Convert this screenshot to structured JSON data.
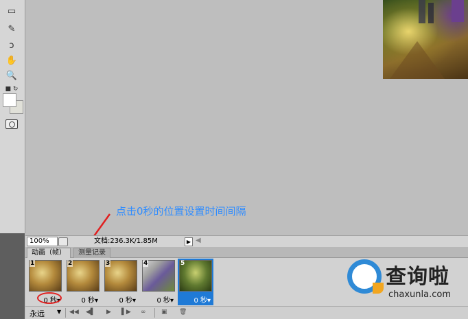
{
  "toolbar": {
    "tools": [
      {
        "name": "marquee-tool-icon",
        "glyph": "▭"
      },
      {
        "name": "quick-selection-tool-icon",
        "glyph": "✎"
      },
      {
        "name": "lasso-tool-icon",
        "glyph": "ↄ"
      },
      {
        "name": "hand-tool-icon",
        "glyph": "✋"
      },
      {
        "name": "zoom-tool-icon",
        "glyph": "🔍"
      }
    ],
    "foreground_color": "#ffffff",
    "background_color": "#e0e0d8"
  },
  "annotation": {
    "text": "点击0秒的位置设置时间间隔",
    "color": "#2f8cff",
    "arrow_color": "#e02020"
  },
  "status_bar": {
    "zoom": "100%",
    "doc_info": "文档:236.3K/1.85M",
    "menu_arrow": "▶",
    "scroll_arrow": "◀"
  },
  "panel": {
    "tabs": [
      {
        "label": "动画（帧）",
        "active": true
      },
      {
        "label": "测量记录",
        "active": false
      }
    ],
    "frames": [
      {
        "number": "1",
        "delay": "0 秒▾",
        "selected": false
      },
      {
        "number": "2",
        "delay": "0 秒▾",
        "selected": false
      },
      {
        "number": "3",
        "delay": "0 秒▾",
        "selected": false
      },
      {
        "number": "4",
        "delay": "0 秒▾",
        "selected": false
      },
      {
        "number": "5",
        "delay": "0 秒▾",
        "selected": true
      }
    ],
    "loop_option": "永远",
    "controls": {
      "first_frame": "◀◀",
      "prev_frame": "◀▌",
      "play": "▶",
      "next_frame": "▌▶",
      "tween": "∞",
      "new_frame": "▣",
      "delete_frame": "🗑"
    }
  },
  "watermark": {
    "title": "查询啦",
    "url": "chaxunla.com"
  }
}
